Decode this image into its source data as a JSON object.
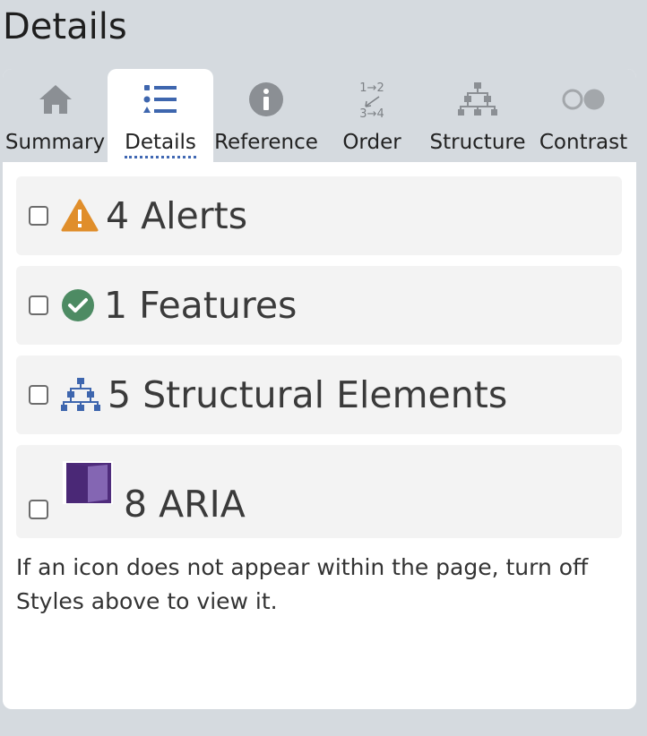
{
  "page": {
    "title": "Details"
  },
  "tabs": [
    {
      "label": "Summary",
      "icon": "home-icon",
      "active": false
    },
    {
      "label": "Details",
      "icon": "list-icon",
      "active": true
    },
    {
      "label": "Reference",
      "icon": "info-icon",
      "active": false
    },
    {
      "label": "Order",
      "icon": "order-icon",
      "active": false,
      "icon_text": [
        "1→2",
        "3→4"
      ]
    },
    {
      "label": "Structure",
      "icon": "structure-icon",
      "active": false
    },
    {
      "label": "Contrast",
      "icon": "contrast-icon",
      "active": false
    }
  ],
  "rows": [
    {
      "label": "4 Alerts",
      "icon": "warning-icon",
      "checked": false
    },
    {
      "label": "1 Features",
      "icon": "check-circle-icon",
      "checked": false
    },
    {
      "label": "5 Structural Elements",
      "icon": "structure-icon",
      "checked": false
    },
    {
      "label": "8 ARIA",
      "icon": "aria-box-icon",
      "checked": false
    }
  ],
  "note": "If an icon does not appear within the page, turn off Styles above to view it.",
  "colors": {
    "background": "#d5dadf",
    "tab_icon": "#8b8f94",
    "active_icon": "#3e66ae",
    "warning": "#e08e2b",
    "feature": "#4d8b63",
    "structure": "#3e66ae",
    "aria": "#4f2c7c"
  }
}
